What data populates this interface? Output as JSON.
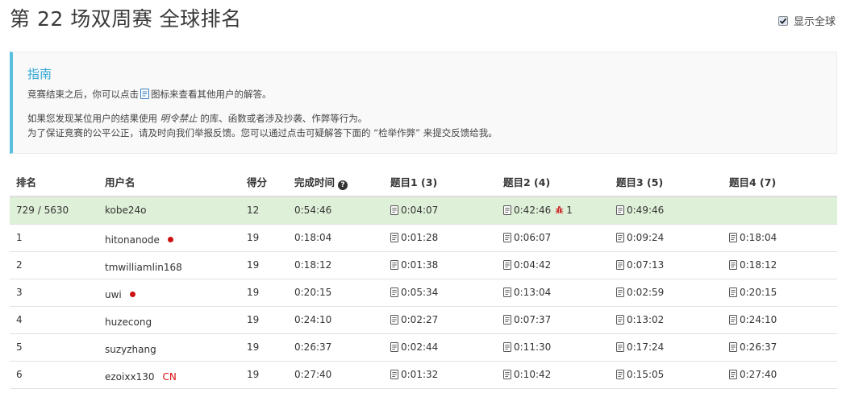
{
  "page": {
    "title": "第 22 场双周赛 全球排名",
    "show_global_label": "显示全球",
    "show_global_checked": true
  },
  "guide": {
    "title": "指南",
    "line1_before": "竞赛结束之后，你可以点击",
    "line1_after": "图标来查看其他用户的解答。",
    "line2_before": "如果您发现某位用户的结果使用 ",
    "line2_em": "明令禁止",
    "line2_after": " 的库、函数或者涉及抄袭、作弊等行为。",
    "line3": "为了保证竞赛的公平公正，请及时向我们举报反馈。您可以通过点击可疑解答下面的 “检举作弊” 来提交反馈给我。"
  },
  "table": {
    "headers": {
      "rank": "排名",
      "user": "用户名",
      "score": "得分",
      "finish_time": "完成时间",
      "q1": "题目1 (3)",
      "q2": "题目2 (4)",
      "q3": "题目3 (5)",
      "q4": "题目4 (7)"
    },
    "rows": [
      {
        "rank": "729 / 5630",
        "user": "kobe24o",
        "score": "12",
        "time": "0:54:46",
        "q1": "0:04:07",
        "q2": "0:42:46",
        "q2_bugs": "1",
        "q3": "0:49:46",
        "q4": ""
      },
      {
        "rank": "1",
        "user": "hitonanode",
        "score": "19",
        "time": "0:18:04",
        "q1": "0:01:28",
        "q2": "0:06:07",
        "q3": "0:09:24",
        "q4": "0:18:04"
      },
      {
        "rank": "2",
        "user": "tmwilliamlin168",
        "score": "19",
        "time": "0:18:12",
        "q1": "0:01:38",
        "q2": "0:04:42",
        "q3": "0:07:13",
        "q4": "0:18:12"
      },
      {
        "rank": "3",
        "user": "uwi",
        "score": "19",
        "time": "0:20:15",
        "q1": "0:05:34",
        "q2": "0:13:04",
        "q3": "0:02:59",
        "q4": "0:20:15"
      },
      {
        "rank": "4",
        "user": "huzecong",
        "score": "19",
        "time": "0:24:10",
        "q1": "0:02:27",
        "q2": "0:07:37",
        "q3": "0:13:02",
        "q4": "0:24:10"
      },
      {
        "rank": "5",
        "user": "suzyzhang",
        "score": "19",
        "time": "0:26:37",
        "q1": "0:02:44",
        "q2": "0:11:30",
        "q3": "0:17:24",
        "q4": "0:26:37"
      },
      {
        "rank": "6",
        "user": "ezoixx130",
        "country": "CN",
        "score": "19",
        "time": "0:27:40",
        "q1": "0:01:32",
        "q2": "0:10:42",
        "q3": "0:15:05",
        "q4": "0:27:40"
      }
    ]
  },
  "colors": {
    "accent_blue": "#5bc0de",
    "guide_title": "#31a7d4",
    "highlight_row": "#dff0d8",
    "red_marker": "#cc1111"
  },
  "icons": [
    "doc-icon",
    "help-icon",
    "bug-icon",
    "red-dot-icon",
    "checkbox-icon"
  ]
}
